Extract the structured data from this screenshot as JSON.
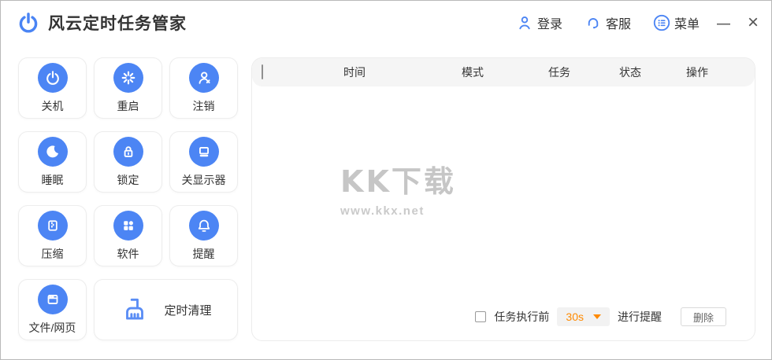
{
  "window": {
    "title": "风云定时任务管家",
    "minimize_glyph": "—",
    "close_glyph": "×"
  },
  "titlebar": {
    "login_label": "登录",
    "service_label": "客服",
    "menu_label": "菜单"
  },
  "sidebar": {
    "buttons": [
      {
        "label": "关机",
        "icon": "power-icon"
      },
      {
        "label": "重启",
        "icon": "restart-icon"
      },
      {
        "label": "注销",
        "icon": "logout-icon"
      },
      {
        "label": "睡眠",
        "icon": "sleep-icon"
      },
      {
        "label": "锁定",
        "icon": "lock-icon"
      },
      {
        "label": "关显示器",
        "icon": "monitor-off-icon"
      },
      {
        "label": "压缩",
        "icon": "compress-icon"
      },
      {
        "label": "软件",
        "icon": "software-icon"
      },
      {
        "label": "提醒",
        "icon": "bell-icon"
      },
      {
        "label": "文件/网页",
        "icon": "file-web-icon"
      }
    ],
    "clean_button": {
      "label": "定时清理",
      "icon": "broom-icon"
    }
  },
  "table": {
    "columns": [
      "时间",
      "模式",
      "任务",
      "状态",
      "操作"
    ],
    "rows": []
  },
  "watermark": {
    "title": "KK下载",
    "url": "www.kkx.net"
  },
  "footer": {
    "before_label": "任务执行前",
    "delay_value": "30s",
    "after_label": "进行提醒",
    "delete_label": "删除"
  },
  "colors": {
    "accent": "#4c85f4",
    "orange": "#ff8a00",
    "header_bg": "#f5f5f5"
  }
}
